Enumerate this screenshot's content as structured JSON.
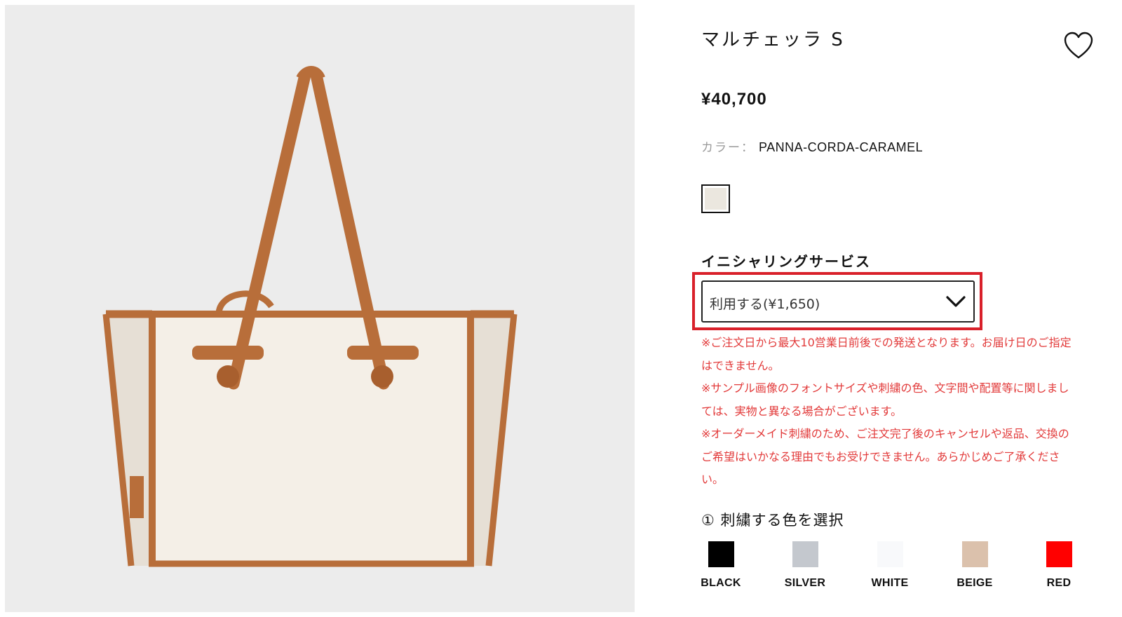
{
  "product": {
    "title": "マルチェッラ S",
    "price": "¥40,700",
    "favorite_icon": "heart-outline-icon",
    "color_label": "カラー：",
    "color_value": "PANNA-CORDA-CARAMEL",
    "swatch_color": "#ebe7df"
  },
  "initial_service": {
    "heading": "イニシャリングサービス",
    "selected_option": "利用する(¥1,650)",
    "chevron_icon": "chevron-down-icon",
    "highlight_color": "#d9202a"
  },
  "notes": [
    "※ご注文日から最大10営業日前後での発送となります。お届け日のご指定",
    "はできません。",
    "※サンプル画像のフォントサイズや刺繍の色、文字間や配置等に関しまし",
    "ては、実物と異なる場合がございます。",
    "※オーダーメイド刺繍のため、ご注文完了後のキャンセルや返品、交換の",
    "ご希望はいかなる理由でもお受けできません。あらかじめご了承くださ",
    "い。"
  ],
  "embroidery": {
    "heading": "① 刺繍する色を選択",
    "options": [
      {
        "label": "BLACK",
        "color": "#000000"
      },
      {
        "label": "SILVER",
        "color": "#c4c8ce"
      },
      {
        "label": "WHITE",
        "color": "#f8f9fb"
      },
      {
        "label": "BEIGE",
        "color": "#dbc1ac"
      },
      {
        "label": "RED",
        "color": "#ff0000"
      }
    ]
  },
  "colors": {
    "image_background": "#ececec",
    "note_text": "#e23a3a",
    "leather": "#b86e3a",
    "canvas": "#f3eee6"
  }
}
